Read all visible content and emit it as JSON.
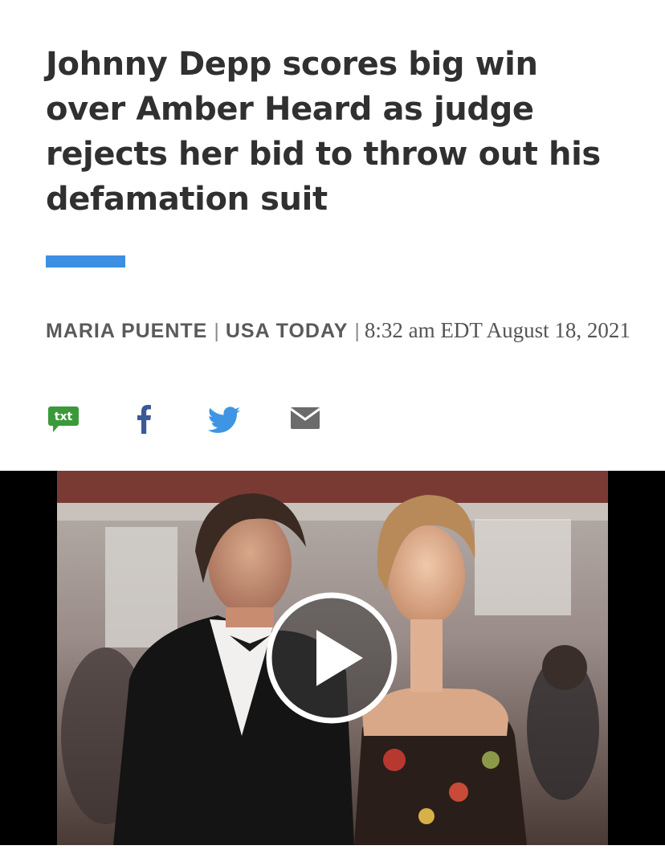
{
  "article": {
    "headline": "Johnny Depp scores big win over Amber Heard as judge rejects her bid to throw out his defamation suit",
    "accent_color": "#3d8fe4",
    "byline": {
      "author": "MARIA PUENTE",
      "separator": "|",
      "outlet": "USA TODAY",
      "timestamp": "8:32 am EDT August 18, 2021"
    }
  },
  "share": {
    "items": [
      {
        "icon": "sms-txt-icon",
        "label": "txt",
        "color": "#3a9a3a"
      },
      {
        "icon": "facebook-icon",
        "color": "#3b5998"
      },
      {
        "icon": "twitter-icon",
        "color": "#3d95e4"
      },
      {
        "icon": "email-icon",
        "color": "#6b6b6b"
      }
    ]
  },
  "video": {
    "play_icon": "play-icon"
  }
}
